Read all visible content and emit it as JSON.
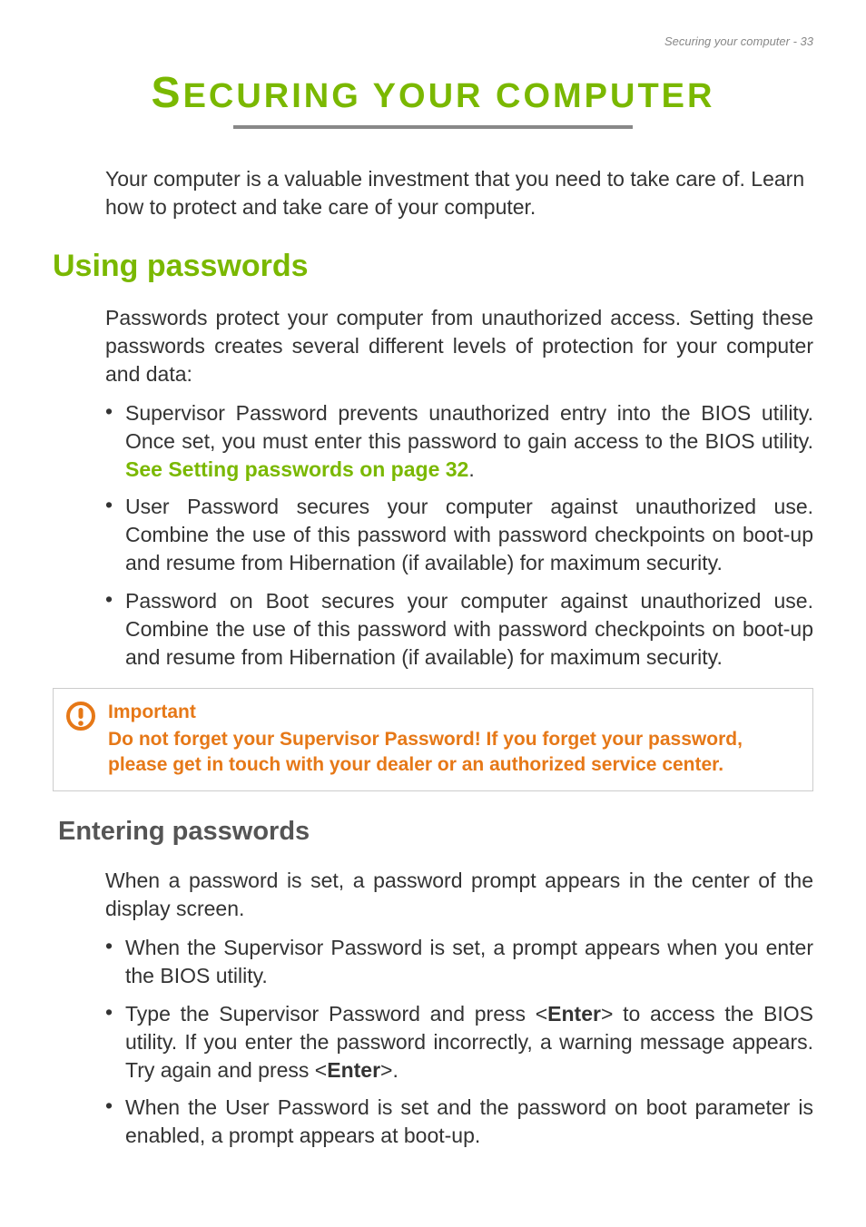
{
  "header": {
    "text": "Securing your computer - 33"
  },
  "title": {
    "first_char": "S",
    "rest": "ECURING YOUR COMPUTER"
  },
  "intro": "Your computer is a valuable investment that you need to take care of. Learn how to protect and take care of your computer.",
  "section1": {
    "heading": "Using passwords",
    "para": "Passwords protect your computer from unauthorized access. Setting these passwords creates several different levels of protection for your computer and data:",
    "bullets": {
      "b1_pre": "Supervisor Password prevents unauthorized entry into the BIOS utility. Once set, you must enter this password to gain access to the BIOS utility. ",
      "b1_link": "See Setting passwords on page 32",
      "b1_post": ".",
      "b2": "User Password secures your computer against unauthorized use. Combine the use of this password with password checkpoints on boot-up and resume from Hibernation (if available) for maximum security.",
      "b3": "Password on Boot secures your computer against unauthorized use. Combine the use of this password with password checkpoints on boot-up and resume from Hibernation (if available) for maximum security."
    }
  },
  "callout": {
    "title": "Important",
    "text": "Do not forget your Supervisor Password! If you forget your password, please get in touch with your dealer or an authorized service center."
  },
  "section2": {
    "heading": "Entering passwords",
    "para": "When a password is set, a password prompt appears in the center of the display screen.",
    "bullets": {
      "b1": "When the Supervisor Password is set, a prompt appears when you enter the BIOS utility.",
      "b2_pre": "Type the Supervisor Password and press <",
      "b2_bold1": "Enter",
      "b2_mid": "> to access the BIOS utility. If you enter the password incorrectly, a warning message appears. Try again and press <",
      "b2_bold2": "Enter",
      "b2_post": ">.",
      "b3": "When the User Password is set and the password on boot parameter is enabled, a prompt appears at boot-up."
    }
  }
}
